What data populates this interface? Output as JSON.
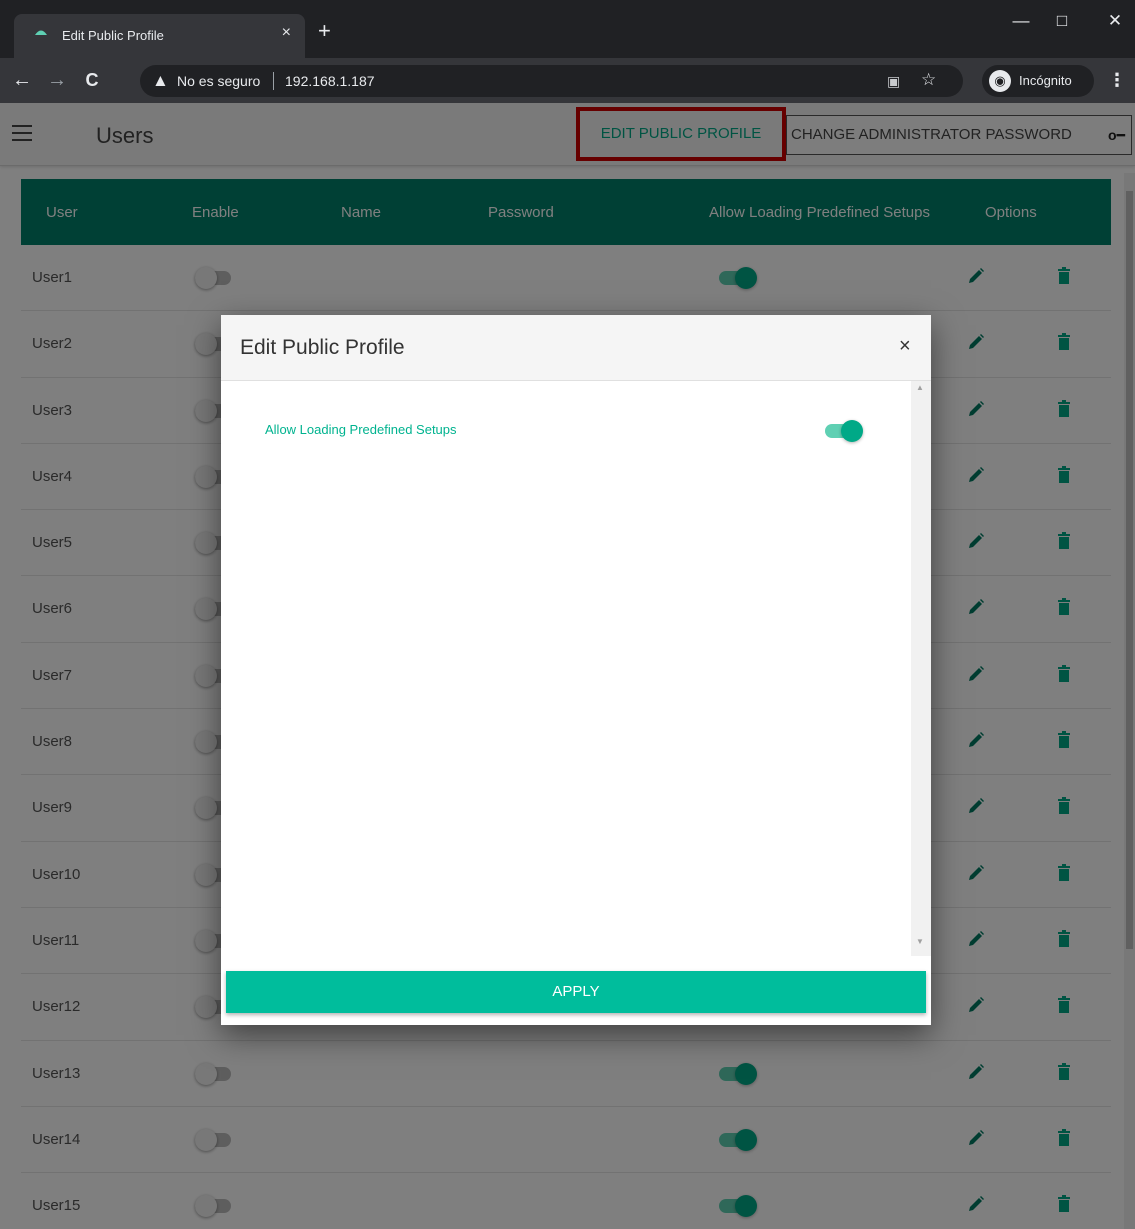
{
  "browser": {
    "tab_title": "Edit Public Profile",
    "tab_close": "×",
    "new_tab": "+",
    "win_minimize": "—",
    "win_maximize": "□",
    "win_close": "✕",
    "back": "←",
    "forward": "→",
    "reload": "C",
    "security_warning": "No es seguro",
    "url": "192.168.1.187",
    "incognito_label": "Incógnito",
    "menu": "⋮"
  },
  "app": {
    "title": "Users",
    "edit_public_profile": "EDIT PUBLIC PROFILE",
    "change_admin_password": "CHANGE ADMINISTRATOR PASSWORD",
    "accent_color": "#00806a",
    "highlight_color": "#cc0000"
  },
  "table": {
    "headers": [
      "User",
      "Enable",
      "Name",
      "Password",
      "Allow Loading Predefined Setups",
      "Options"
    ],
    "rows": [
      {
        "user": "User1",
        "enable": false,
        "allow": true
      },
      {
        "user": "User2",
        "enable": false,
        "allow": true
      },
      {
        "user": "User3",
        "enable": false,
        "allow": true
      },
      {
        "user": "User4",
        "enable": false,
        "allow": true
      },
      {
        "user": "User5",
        "enable": false,
        "allow": true
      },
      {
        "user": "User6",
        "enable": false,
        "allow": true
      },
      {
        "user": "User7",
        "enable": false,
        "allow": true
      },
      {
        "user": "User8",
        "enable": false,
        "allow": true
      },
      {
        "user": "User9",
        "enable": false,
        "allow": true
      },
      {
        "user": "User10",
        "enable": false,
        "allow": true
      },
      {
        "user": "User11",
        "enable": false,
        "allow": true
      },
      {
        "user": "User12",
        "enable": false,
        "allow": true
      },
      {
        "user": "User13",
        "enable": false,
        "allow": true
      },
      {
        "user": "User14",
        "enable": false,
        "allow": true
      },
      {
        "user": "User15",
        "enable": false,
        "allow": true
      }
    ]
  },
  "modal": {
    "title": "Edit Public Profile",
    "close": "×",
    "setting_label": "Allow Loading Predefined Setups",
    "setting_enabled": true,
    "apply": "APPLY"
  }
}
